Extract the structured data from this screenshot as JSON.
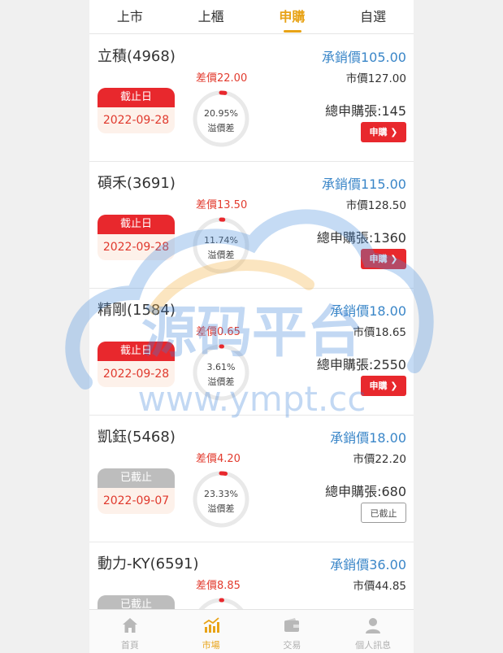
{
  "tabs": [
    {
      "label": "上市",
      "active": false
    },
    {
      "label": "上櫃",
      "active": false
    },
    {
      "label": "申購",
      "active": true
    },
    {
      "label": "自選",
      "active": false
    }
  ],
  "cards": [
    {
      "name": "立積(4968)",
      "underwriting": "承銷價105.00",
      "market": "市價127.00",
      "diff": "差價22.00",
      "pct": "20.95%",
      "pct_value": 20.95,
      "pct_label": "溢價差",
      "status": "截止日",
      "status_kind": "open",
      "date": "2022-09-28",
      "total": "總申購張:145",
      "button": "申購 ❯"
    },
    {
      "name": "碩禾(3691)",
      "underwriting": "承銷價115.00",
      "market": "市價128.50",
      "diff": "差價13.50",
      "pct": "11.74%",
      "pct_value": 11.74,
      "pct_label": "溢價差",
      "status": "截止日",
      "status_kind": "open",
      "date": "2022-09-28",
      "total": "總申購張:1360",
      "button": "申購 ❯"
    },
    {
      "name": "精剛(1584)",
      "underwriting": "承銷價18.00",
      "market": "市價18.65",
      "diff": "差價0.65",
      "pct": "3.61%",
      "pct_value": 3.61,
      "pct_label": "溢價差",
      "status": "截止日",
      "status_kind": "open",
      "date": "2022-09-28",
      "total": "總申購張:2550",
      "button": "申購 ❯"
    },
    {
      "name": "凱鈺(5468)",
      "underwriting": "承銷價18.00",
      "market": "市價22.20",
      "diff": "差價4.20",
      "pct": "23.33%",
      "pct_value": 23.33,
      "pct_label": "溢價差",
      "status": "已截止",
      "status_kind": "closed",
      "date": "2022-09-07",
      "total": "總申購張:680",
      "button": "已截止"
    },
    {
      "name": "動力-KY(6591)",
      "underwriting": "承銷價36.00",
      "market": "市價44.85",
      "diff": "差價8.85",
      "pct": "",
      "pct_value": null,
      "pct_label": "",
      "status": "已截止",
      "status_kind": "closed",
      "date": "",
      "total": "",
      "button": ""
    }
  ],
  "nav": [
    {
      "label": "首頁",
      "icon": "home-icon",
      "active": false
    },
    {
      "label": "市場",
      "icon": "chart-icon",
      "active": true
    },
    {
      "label": "交易",
      "icon": "wallet-icon",
      "active": false
    },
    {
      "label": "個人訊息",
      "icon": "user-icon",
      "active": false
    }
  ],
  "watermark": {
    "title": "源码平台",
    "url": "www.ympt.cc"
  },
  "colors": {
    "accent": "#e8a317",
    "red": "#e8282d",
    "blue": "#3a86c8",
    "grey": "#bdbdbd"
  }
}
